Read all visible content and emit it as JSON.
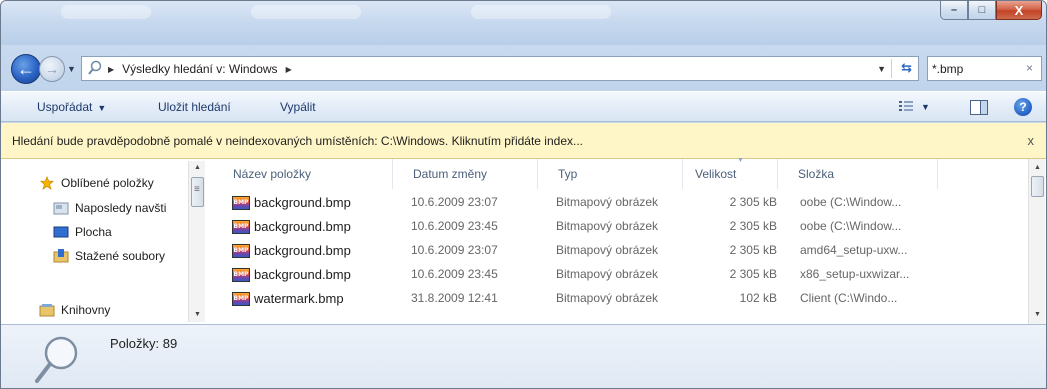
{
  "window": {
    "buttons": {
      "minimize": "–",
      "maximize": "□",
      "close": "X"
    }
  },
  "nav": {
    "breadcrumb": [
      "Výsledky hledání v: Windows"
    ],
    "search_value": "*.bmp",
    "search_clear": "×"
  },
  "toolbar": {
    "organize_label": "Uspořádat",
    "save_search_label": "Uložit hledání",
    "burn_label": "Vypálit",
    "help_label": "?"
  },
  "infobar": {
    "text": "Hledání bude pravděpodobně pomalé v neindexovaných umístěních: C:\\Windows. Kliknutím přidáte index...",
    "close": "x"
  },
  "sidebar": {
    "items": [
      {
        "label": "Oblíbené položky",
        "icon": "star-icon"
      },
      {
        "label": "Naposledy navšti",
        "icon": "recent-places-icon"
      },
      {
        "label": "Plocha",
        "icon": "desktop-icon"
      },
      {
        "label": "Stažené soubory",
        "icon": "downloads-folder-icon"
      },
      {
        "label": "Knihovny",
        "icon": "libraries-icon"
      }
    ]
  },
  "columns": {
    "name": "Název položky",
    "date": "Datum změny",
    "type": "Typ",
    "size": "Velikost",
    "folder": "Složka"
  },
  "files": [
    {
      "name": "background.bmp",
      "date": "10.6.2009 23:07",
      "type": "Bitmapový obrázek",
      "size": "2 305 kB",
      "folder": "oobe (C:\\Window..."
    },
    {
      "name": "background.bmp",
      "date": "10.6.2009 23:45",
      "type": "Bitmapový obrázek",
      "size": "2 305 kB",
      "folder": "oobe (C:\\Window..."
    },
    {
      "name": "background.bmp",
      "date": "10.6.2009 23:07",
      "type": "Bitmapový obrázek",
      "size": "2 305 kB",
      "folder": "amd64_setup-uxw..."
    },
    {
      "name": "background.bmp",
      "date": "10.6.2009 23:45",
      "type": "Bitmapový obrázek",
      "size": "2 305 kB",
      "folder": "x86_setup-uxwizar..."
    },
    {
      "name": "watermark.bmp",
      "date": "31.8.2009 12:41",
      "type": "Bitmapový obrázek",
      "size": "102 kB",
      "folder": "Client (C:\\Windo..."
    }
  ],
  "file_icon_label": "BMP",
  "status": {
    "items_text": "Položky: 89"
  },
  "colors": {
    "infobar_bg": "#fff6c7",
    "chrome_blue": "#c9d9ec",
    "accent": "#2a63c3"
  }
}
